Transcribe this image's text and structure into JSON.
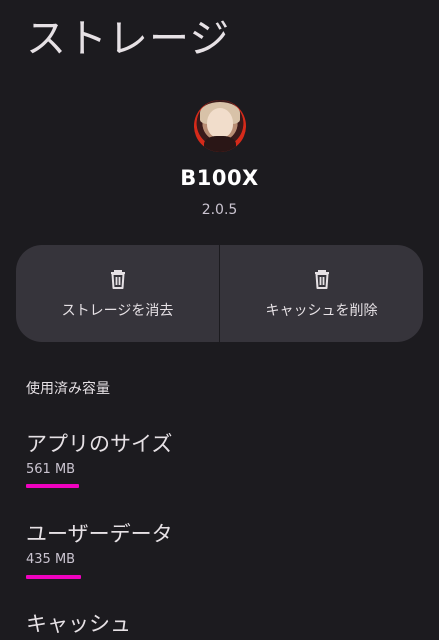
{
  "page_title": "ストレージ",
  "app": {
    "name": "B100X",
    "version": "2.0.5"
  },
  "actions": {
    "clear_storage": "ストレージを消去",
    "clear_cache": "キャッシュを削除"
  },
  "section_label": "使用済み容量",
  "usage": {
    "app_size": {
      "title": "アプリのサイズ",
      "value": "561 MB"
    },
    "user_data": {
      "title": "ユーザーデータ",
      "value": "435 MB"
    },
    "cache": {
      "title": "キャッシュ"
    }
  },
  "colors": {
    "background": "#1c1b1f",
    "card": "#36343b",
    "highlight": "#f002c0"
  },
  "icons": {
    "clear_storage": "trash-icon",
    "clear_cache": "trash-icon"
  }
}
